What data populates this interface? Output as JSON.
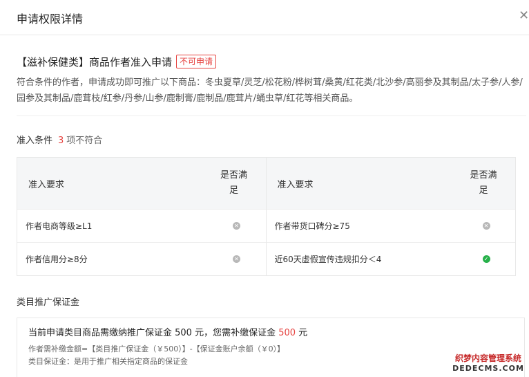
{
  "header": {
    "title": "申请权限详情",
    "close_glyph": "✕"
  },
  "application": {
    "title": "【滋补保健类】商品作者准入申请",
    "status_badge": "不可申请",
    "description": "符合条件的作者，申请成功即可推广以下商品：冬虫夏草/灵芝/松花粉/桦树茸/桑黄/红花类/北沙参/高丽参及其制品/太子参/人参/园参及其制品/鹿茸枝/红参/丹参/山参/鹿制膏/鹿制品/鹿茸片/蛹虫草/红花等相关商品。"
  },
  "conditions": {
    "title": "准入条件",
    "unmet_count": "3",
    "unmet_suffix": "项不符合",
    "columns": {
      "requirement": "准入要求",
      "met_line1": "是否满",
      "met_line2": "足"
    },
    "left_rows": [
      {
        "requirement": "作者电商等级≥L1",
        "met": false
      },
      {
        "requirement": "作者信用分≥8分",
        "met": false
      }
    ],
    "right_rows": [
      {
        "requirement": "作者带货口碑分≥75",
        "met": false
      },
      {
        "requirement": "近60天虚假宣传违规扣分＜4",
        "met": true
      }
    ]
  },
  "deposit": {
    "title": "类目推广保证金",
    "main_prefix": "当前申请类目商品需缴纳推广保证金 500 元，您需补缴保证金 ",
    "main_amount": "500",
    "main_suffix": " 元",
    "formula": "作者需补缴金额=【类目推广保证金（￥500）】-【保证金账户余额（￥0）】",
    "note": "类目保证金：是用于推广相关指定商品的保证金"
  },
  "watermark": {
    "line1": "织梦内容管理系统",
    "line2": "DEDECMS.COM"
  },
  "colors": {
    "accent_red": "#e64340",
    "pass_green": "#27b14a",
    "fail_grey": "#b8b8b8"
  },
  "icons": {
    "fail": "x-circle-icon",
    "pass": "check-circle-icon"
  }
}
